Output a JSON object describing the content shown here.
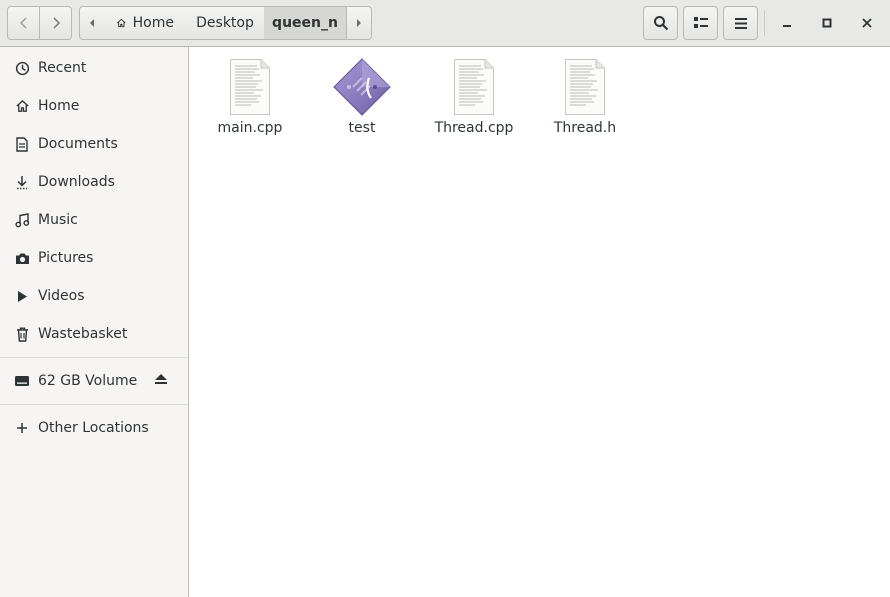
{
  "toolbar": {
    "breadcrumbs": [
      "Home",
      "Desktop",
      "queen_n"
    ]
  },
  "sidebar": {
    "items": [
      {
        "label": "Recent",
        "icon": "clock-icon"
      },
      {
        "label": "Home",
        "icon": "home-icon"
      },
      {
        "label": "Documents",
        "icon": "document-icon"
      },
      {
        "label": "Downloads",
        "icon": "download-icon"
      },
      {
        "label": "Music",
        "icon": "music-icon"
      },
      {
        "label": "Pictures",
        "icon": "camera-icon"
      },
      {
        "label": "Videos",
        "icon": "video-icon"
      },
      {
        "label": "Wastebasket",
        "icon": "trash-icon"
      }
    ],
    "volume": {
      "label": "62 GB Volume",
      "icon": "drive-icon"
    },
    "other": {
      "label": "Other Locations",
      "icon": "plus-icon"
    }
  },
  "files": [
    {
      "name": "main.cpp",
      "icon": "text-file-icon"
    },
    {
      "name": "test",
      "icon": "executable-icon"
    },
    {
      "name": "Thread.cpp",
      "icon": "text-file-icon"
    },
    {
      "name": "Thread.h",
      "icon": "text-file-icon"
    }
  ],
  "colors": {
    "header_bg": "#e8e8e7",
    "sidebar_bg": "#f6f5f4",
    "executable_accent": "#8c7fc0"
  }
}
